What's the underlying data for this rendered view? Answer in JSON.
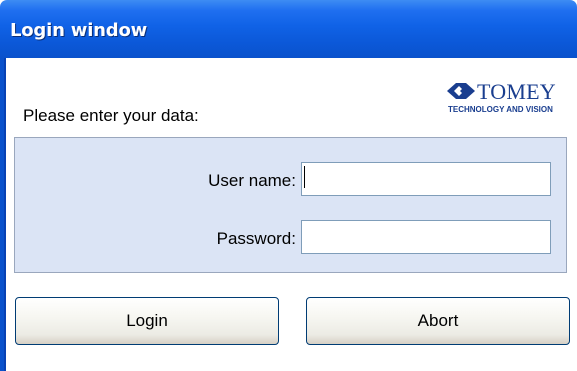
{
  "window": {
    "title": "Login window"
  },
  "logo": {
    "name": "TOMEY",
    "tagline": "TECHNOLOGY AND VISION",
    "icon": "tomey-logo-icon",
    "color": "#1a3e8f"
  },
  "form": {
    "prompt": "Please enter your data:",
    "username_label": "User name:",
    "username_value": "",
    "password_label": "Password:",
    "password_value": "",
    "background_color": "#dbe4f5"
  },
  "buttons": {
    "login_label": "Login",
    "abort_label": "Abort"
  },
  "colors": {
    "titlebar": "#0b58d8",
    "title_text": "#ffffff"
  }
}
